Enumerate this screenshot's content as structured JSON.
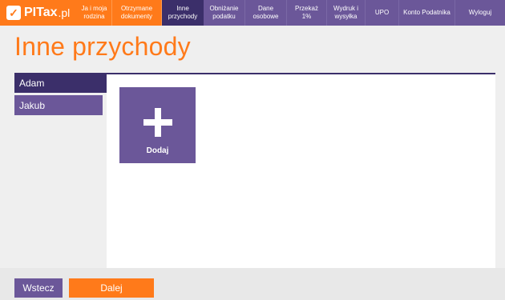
{
  "header": {
    "logo_mark": "✓",
    "logo_text": "PITax",
    "logo_suffix": ".pl",
    "nav": [
      {
        "label": "Ja i moja rodzina"
      },
      {
        "label": "Otrzymane dokumenty"
      },
      {
        "label": "Inne przychody"
      },
      {
        "label": "Obniżanie podatku"
      },
      {
        "label": "Dane osobowe"
      },
      {
        "label": "Przekaż 1%"
      },
      {
        "label": "Wydruk i wysyłka"
      },
      {
        "label": "UPO"
      },
      {
        "label": "Konto Podatnika"
      },
      {
        "label": "Wyloguj"
      }
    ]
  },
  "page": {
    "title": "Inne przychody"
  },
  "people": [
    {
      "name": "Adam"
    },
    {
      "name": "Jakub"
    }
  ],
  "content": {
    "add_tile_label": "Dodaj"
  },
  "footer": {
    "back_label": "Wstecz",
    "next_label": "Dalej"
  },
  "colors": {
    "orange": "#ff7a1a",
    "dark_purple": "#3b2f6a",
    "purple": "#6b5799"
  }
}
